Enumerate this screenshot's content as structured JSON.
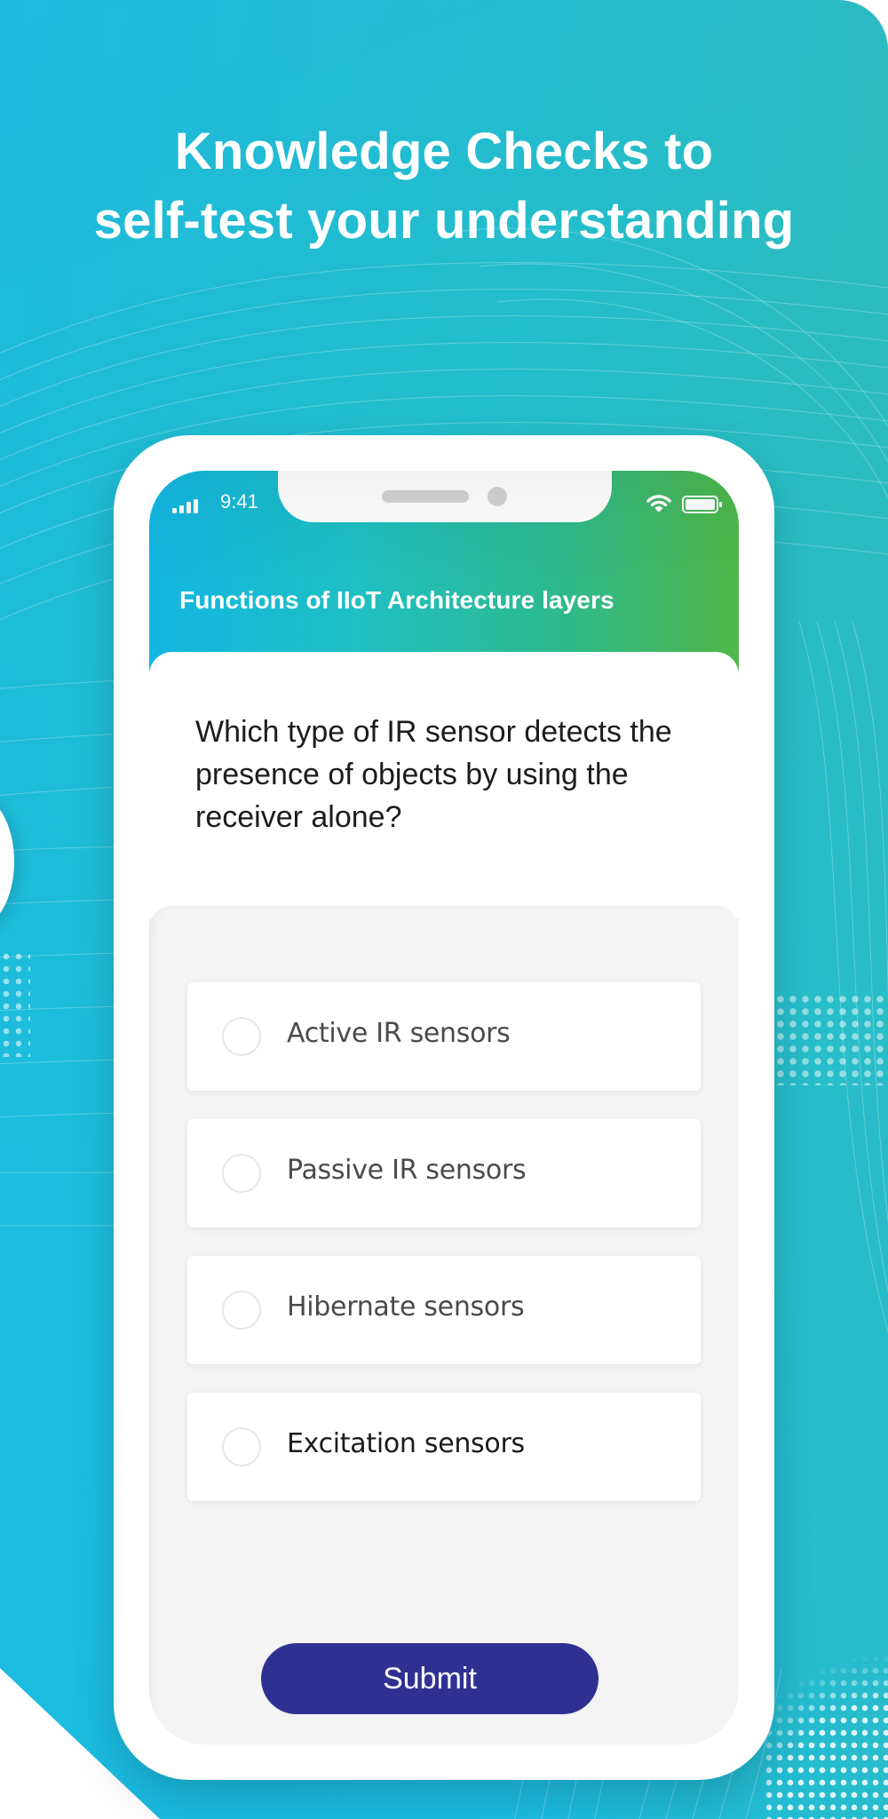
{
  "promo": {
    "headline_line1": "Knowledge Checks to",
    "headline_line2": "self-test your understanding",
    "background_colors": [
      "#1bbde4",
      "#24b9d3",
      "#34bab4"
    ]
  },
  "phone": {
    "status_bar": {
      "time": "9:41",
      "icons": [
        "signal-icon",
        "wifi-icon",
        "battery-icon"
      ]
    },
    "header": {
      "title": "Functions of IIoT Architecture layers",
      "gradient_colors": [
        "#12b6e2",
        "#1fbfc3",
        "#2eb98c",
        "#4fb848"
      ]
    },
    "question": {
      "text": "Which type of IR sensor detects the presence of objects by using the receiver alone?"
    },
    "options": [
      {
        "label": "Active IR sensors",
        "selected": false
      },
      {
        "label": "Passive IR sensors",
        "selected": false
      },
      {
        "label": "Hibernate sensors",
        "selected": false
      },
      {
        "label": "Excitation sensors",
        "selected": false
      }
    ],
    "submit": {
      "label": "Submit",
      "color": "#2f3192"
    }
  }
}
